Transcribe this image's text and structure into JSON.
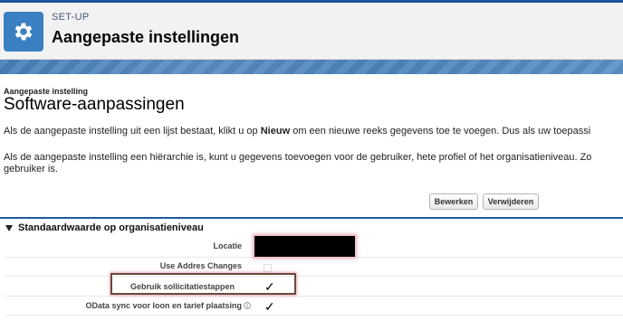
{
  "header": {
    "eyebrow": "SET-UP",
    "title": "Aangepaste instellingen",
    "icon": "gear-icon"
  },
  "page": {
    "eyebrow": "Aangepaste instelling",
    "title": "Software-aanpassingen",
    "description_1": "Als de aangepaste instelling uit een lijst bestaat, klikt u op Nieuw om een nieuwe reeks gegevens toe te voegen. Dus als uw toepassi",
    "description_2_line1": "Als de aangepaste instelling een hiërarchie is, kunt u gegevens toevoegen voor de gebruiker, hete profiel of het organisatieniveau. Zo",
    "description_2_line2": "gebruiker is."
  },
  "buttons": {
    "edit_label": "Bewerken",
    "delete_label": "Verwijderen"
  },
  "section": {
    "title": "Standaardwaarde op organisatieniveau"
  },
  "fields": {
    "locatie_label": "Locatie",
    "use_addres_label": "Use Addres Changes",
    "use_addres_checked": false,
    "gebruik_label": "Gebruik sollicitatiestappen",
    "gebruik_checked": true,
    "odata_label": "OData sync voor loon en tarief plaatsing",
    "odata_checked": true,
    "check_glyph": "✓"
  },
  "colors": {
    "header_icon_bg": "#3a7fc1",
    "accent": "#1f5c99",
    "band": "#4f84bd"
  }
}
